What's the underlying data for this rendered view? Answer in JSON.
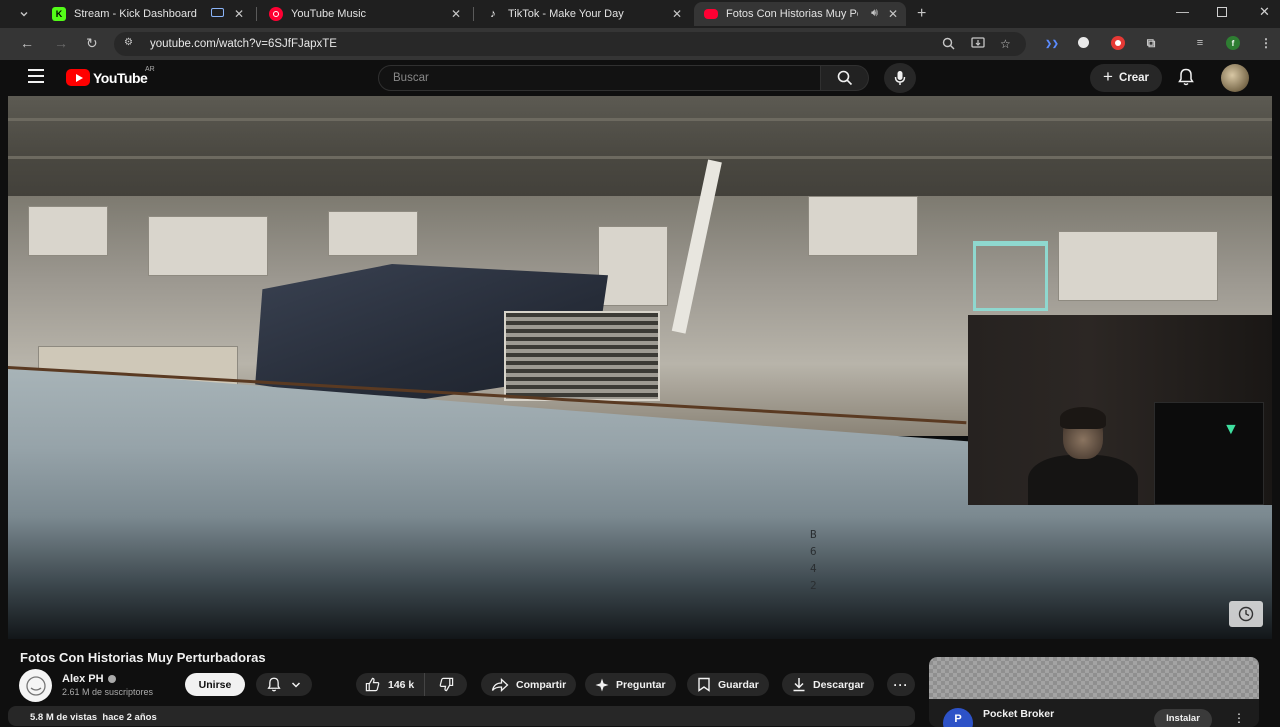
{
  "browser": {
    "tabs": [
      {
        "title": "Stream - Kick Dashboard",
        "favicon": "kick-icon",
        "color": "#53fc18",
        "active": false
      },
      {
        "title": "YouTube Music",
        "favicon": "youtube-music-icon",
        "color": "#ff0033",
        "active": false
      },
      {
        "title": "TikTok - Make Your Day",
        "favicon": "tiktok-icon",
        "color": "#ffffff",
        "active": false
      },
      {
        "title": "Fotos Con Historias Muy Pe",
        "favicon": "youtube-icon",
        "color": "#ff0033",
        "active": true
      }
    ],
    "url": "youtube.com/watch?v=6SJfFJapxTE",
    "profile_initial": "f"
  },
  "youtube": {
    "logo_text": "YouTube",
    "region": "AR",
    "search_placeholder": "Buscar",
    "create_label": "Crear"
  },
  "video": {
    "hull_number": [
      "B",
      "6",
      "4",
      "2"
    ],
    "title": "Fotos Con Historias Muy Perturbadoras",
    "channel_name": "Alex PH",
    "subscribers": "2.61 M de suscriptores",
    "join_label": "Unirse",
    "likes": "146 k",
    "actions": {
      "share": "Compartir",
      "ask": "Preguntar",
      "save": "Guardar",
      "download": "Descargar"
    },
    "views_line": "5.8 M de vistas  hace 2 años"
  },
  "ad": {
    "initial": "P",
    "name": "Pocket Broker",
    "install_label": "Instalar"
  }
}
